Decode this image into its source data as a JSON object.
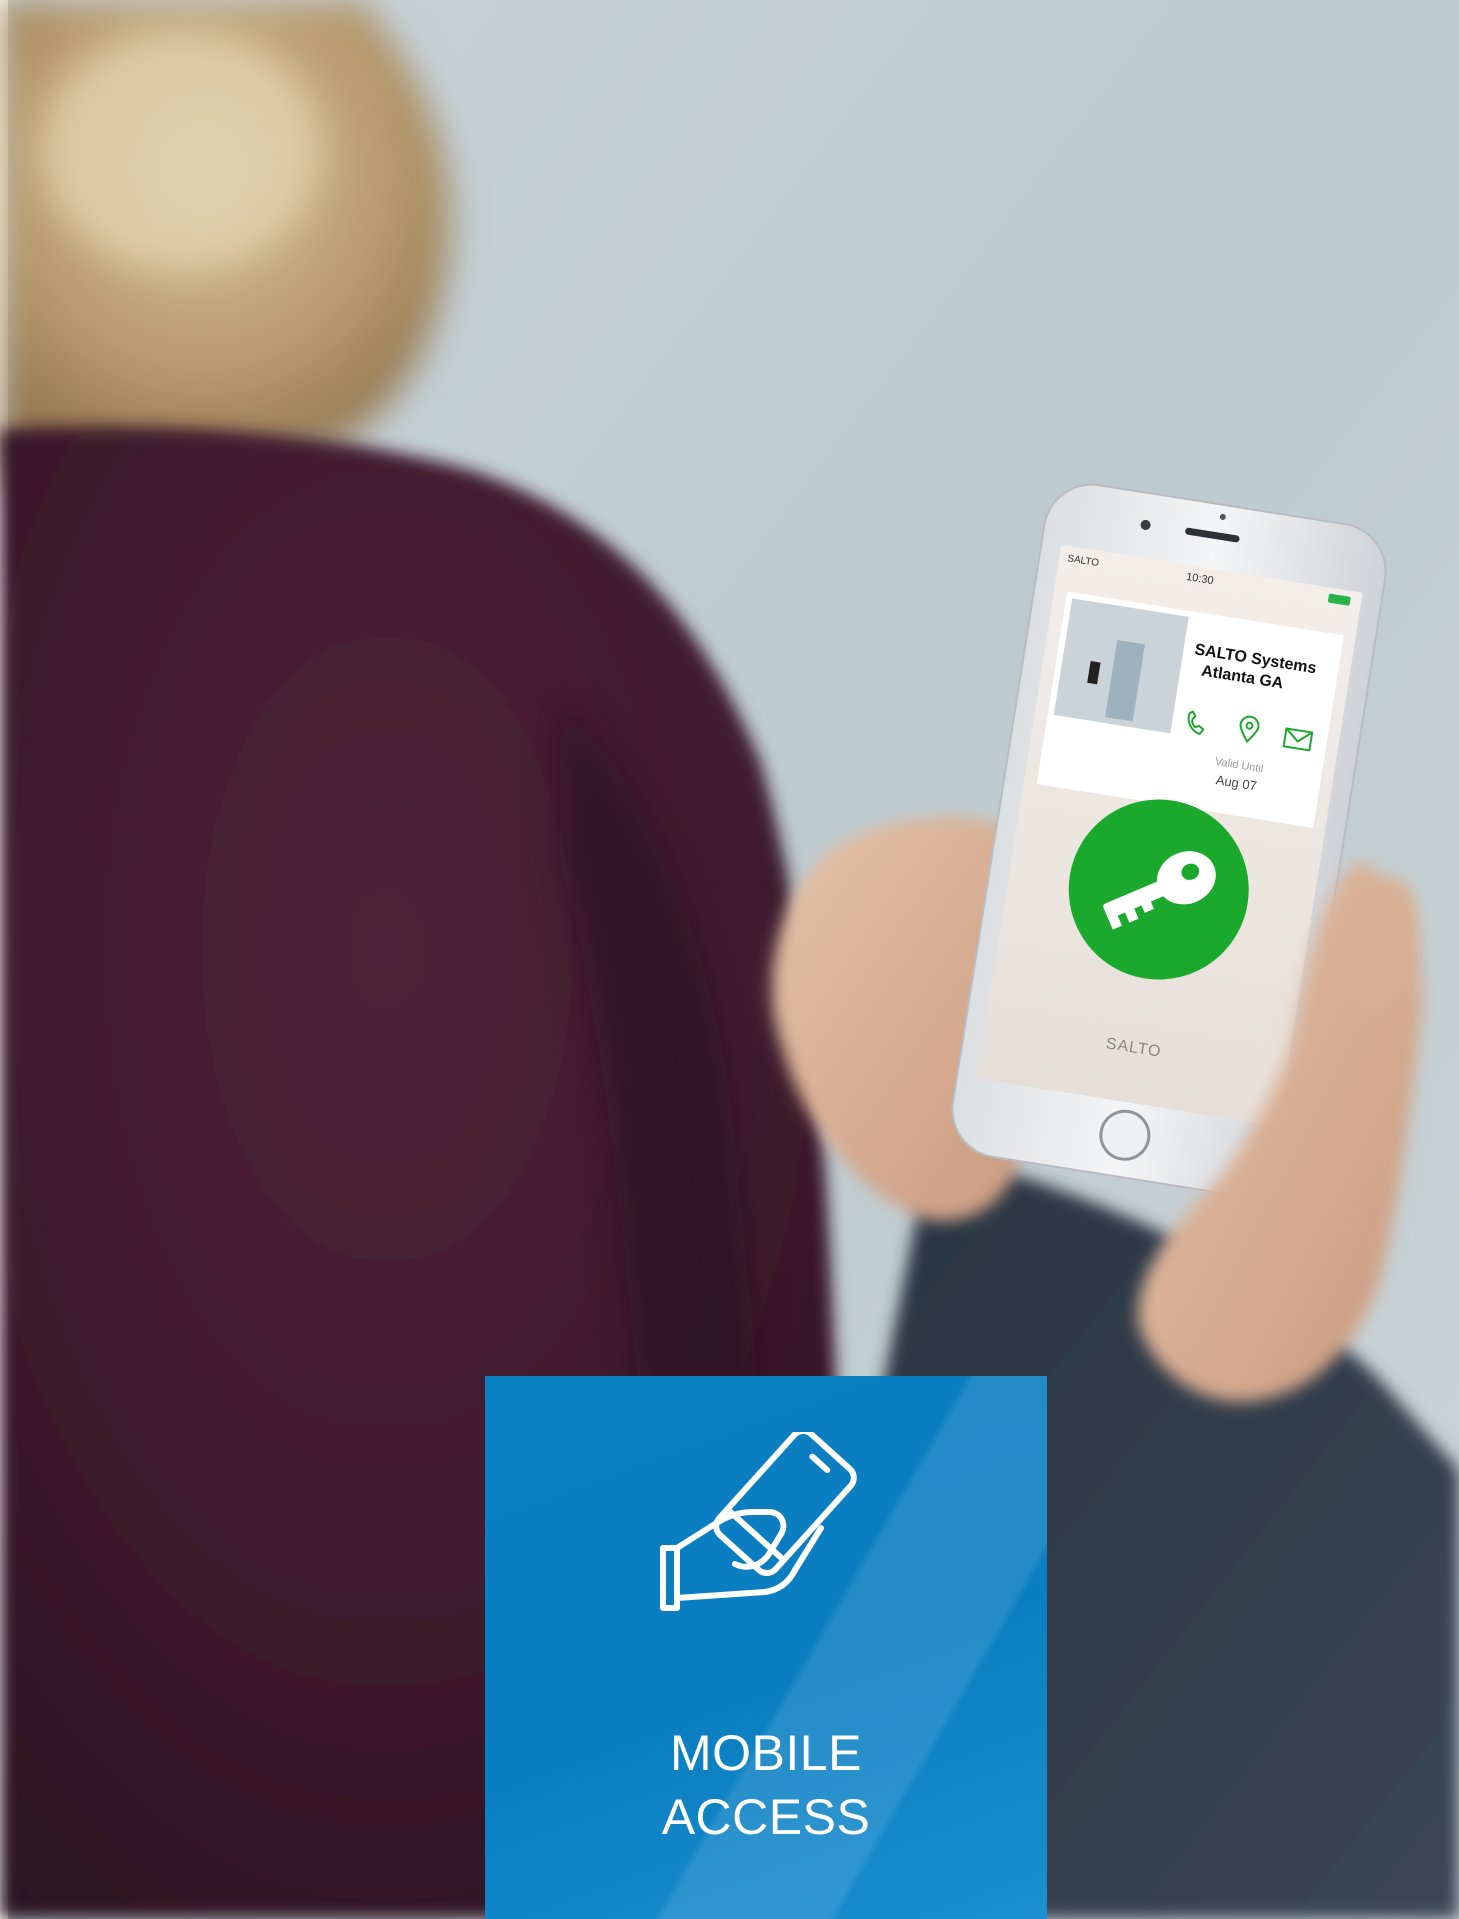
{
  "phone": {
    "status_carrier": "SALTO",
    "status_time": "10:30",
    "site_name_line1": "SALTO Systems",
    "site_name_line2": "Atlanta GA",
    "valid_label": "Valid Until",
    "valid_date": "Aug 07",
    "brand_logo": "SALTO",
    "icons": [
      "phone-icon",
      "location-pin-icon",
      "mail-icon",
      "key-icon"
    ]
  },
  "tile": {
    "icon": "hand-holding-phone-icon",
    "title_line1": "MOBILE",
    "title_line2": "ACCESS"
  },
  "colors": {
    "tile_blue": "#0a7fc2",
    "key_green": "#1aa82d",
    "sweater": "#3d1a2c"
  }
}
